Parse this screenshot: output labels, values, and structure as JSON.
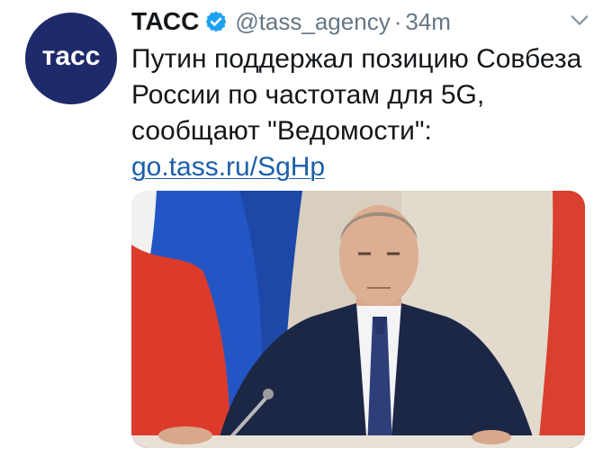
{
  "account": {
    "avatar_text": "тасс",
    "display_name": "ТАСС",
    "verified_icon": "verified-badge-icon",
    "handle": "@tass_agency",
    "separator": "·",
    "time": "34m"
  },
  "menu": {
    "icon": "chevron-down-icon"
  },
  "tweet": {
    "lines": [
      "Путин поддержал позицию Совбеза",
      "России по частотам для 5G,",
      "сообщают \"Ведомости\":"
    ],
    "link": "go.tass.ru/SgHp"
  },
  "media": {
    "description_icon": "photo-thumbnail",
    "colors": {
      "flag_white": "#f2f2f2",
      "flag_blue": "#1f4fb8",
      "flag_red": "#d93a2b",
      "suit": "#1e2a4a",
      "background": "#d9d2c4"
    }
  },
  "colors": {
    "accent": "#1da1f2",
    "avatar_bg": "#1f2a6b",
    "link": "#1b5fa8",
    "secondary_text": "#657786"
  }
}
